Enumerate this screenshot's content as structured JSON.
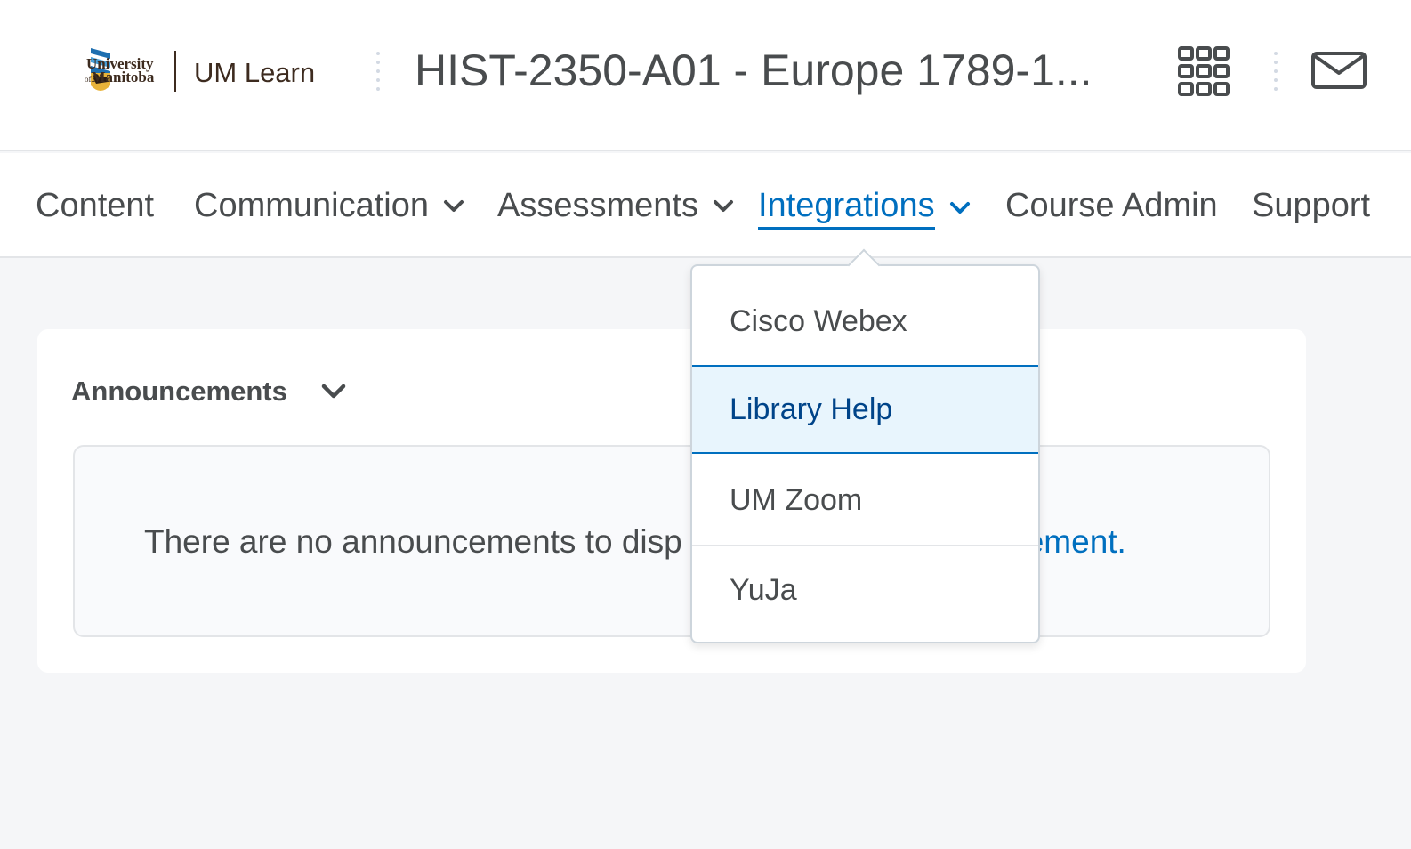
{
  "header": {
    "logo_line1": "University",
    "logo_line2_prefix": "of",
    "logo_line2": "Manitoba",
    "app_name": "UM Learn",
    "course_title": "HIST-2350-A01 - Europe 1789-1..."
  },
  "nav": {
    "items": [
      {
        "label": "Content"
      },
      {
        "label": "Communication"
      },
      {
        "label": "Assessments"
      },
      {
        "label": "Integrations"
      },
      {
        "label": "Course Admin"
      },
      {
        "label": "Support"
      }
    ]
  },
  "widget": {
    "title": "Announcements",
    "empty_text": "There are no announcements to disp",
    "empty_link": "ement."
  },
  "dropdown": {
    "items": [
      {
        "label": "Cisco Webex"
      },
      {
        "label": "Library Help"
      },
      {
        "label": "UM Zoom"
      },
      {
        "label": "YuJa"
      }
    ]
  },
  "colors": {
    "accent": "#006fbf",
    "hover_bg": "#e8f5fd",
    "brand_brown": "#3d2b1f",
    "page_bg": "#f5f6f8"
  },
  "icons": [
    "university-shield-icon",
    "waffle-grid-icon",
    "mail-icon",
    "chevron-down-icon"
  ]
}
